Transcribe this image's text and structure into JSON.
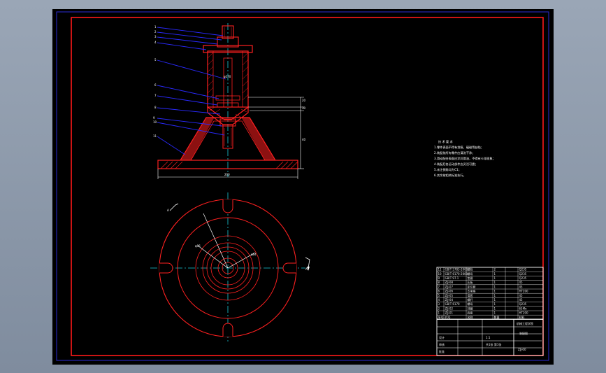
{
  "window": {
    "title": ""
  },
  "colors": {
    "background_outer": "#8b97a8",
    "canvas": "#000000",
    "frame_outer": "#2b2bd6",
    "frame_inner": "#ff1a1a",
    "part_outline": "#ff2020",
    "centerline": "#18c8d8",
    "leader": "#2a2aff",
    "dimension": "#ffffff",
    "hatch": "#ff2020"
  },
  "icons": [
    "section-arrow-icon"
  ],
  "section_view": {
    "balloons": [
      "1",
      "2",
      "3",
      "4",
      "5",
      "6",
      "7",
      "8",
      "9",
      "10",
      "11"
    ],
    "dimension_labels": [
      "20",
      "30",
      "40",
      "200",
      "φ270"
    ]
  },
  "plan_view": {
    "dimension_labels": [
      "φ96",
      "φ64"
    ],
    "section_marks": [
      "A",
      "A"
    ]
  },
  "technical_notes": {
    "title": "技 术 要 求",
    "items": [
      "1.零件表面不得有划痕、磕碰等缺陷；",
      "2.装配前所有零件应清洗干净；",
      "3.滑动配合表面应涂润滑油，不得有卡滞现象；",
      "4.装配后各运动部件应灵活可靠；",
      "5.未注倒角均为C1；",
      "6.其余按相关标准执行。"
    ]
  },
  "parts_list": {
    "rows": [
      [
        "11",
        "GB/T 5783-2000",
        "螺栓",
        "2",
        "",
        "Q235"
      ],
      [
        "10",
        "GB/T 6170-2000",
        "螺母",
        "1",
        "",
        "Q235"
      ],
      [
        "9",
        "GB/T 97.1",
        "垫圈",
        "1",
        "",
        "Q235"
      ],
      [
        "8",
        "ZJJ-08",
        "压板",
        "1",
        "",
        "45"
      ],
      [
        "7",
        "ZJJ-07",
        "定位套",
        "1",
        "",
        "45"
      ],
      [
        "6",
        "ZJJ-06",
        "支承座",
        "1",
        "",
        "HT200"
      ],
      [
        "5",
        "ZJJ-05",
        "滑套",
        "1",
        "",
        "45"
      ],
      [
        "4",
        "ZJJ-04",
        "螺杆",
        "1",
        "",
        "45"
      ],
      [
        "3",
        "GB/T 6170",
        "螺母",
        "1",
        "",
        "Q235"
      ],
      [
        "2",
        "ZJJ-02",
        "挡圈",
        "1",
        "",
        "65Mn"
      ],
      [
        "1",
        "ZJJ-01",
        "底座",
        "1",
        "",
        "HT200"
      ]
    ],
    "header": [
      "序号",
      "代号",
      "名称",
      "数量",
      "",
      "材料"
    ]
  },
  "title_block": {
    "drawing_name": "装配图",
    "school": "机械工程学院",
    "scale": "1:1",
    "drawing_number": "ZJJ-00",
    "sheet": "共1张 第1张",
    "designer_label": "设计",
    "checker_label": "审核",
    "approver_label": "批准"
  }
}
